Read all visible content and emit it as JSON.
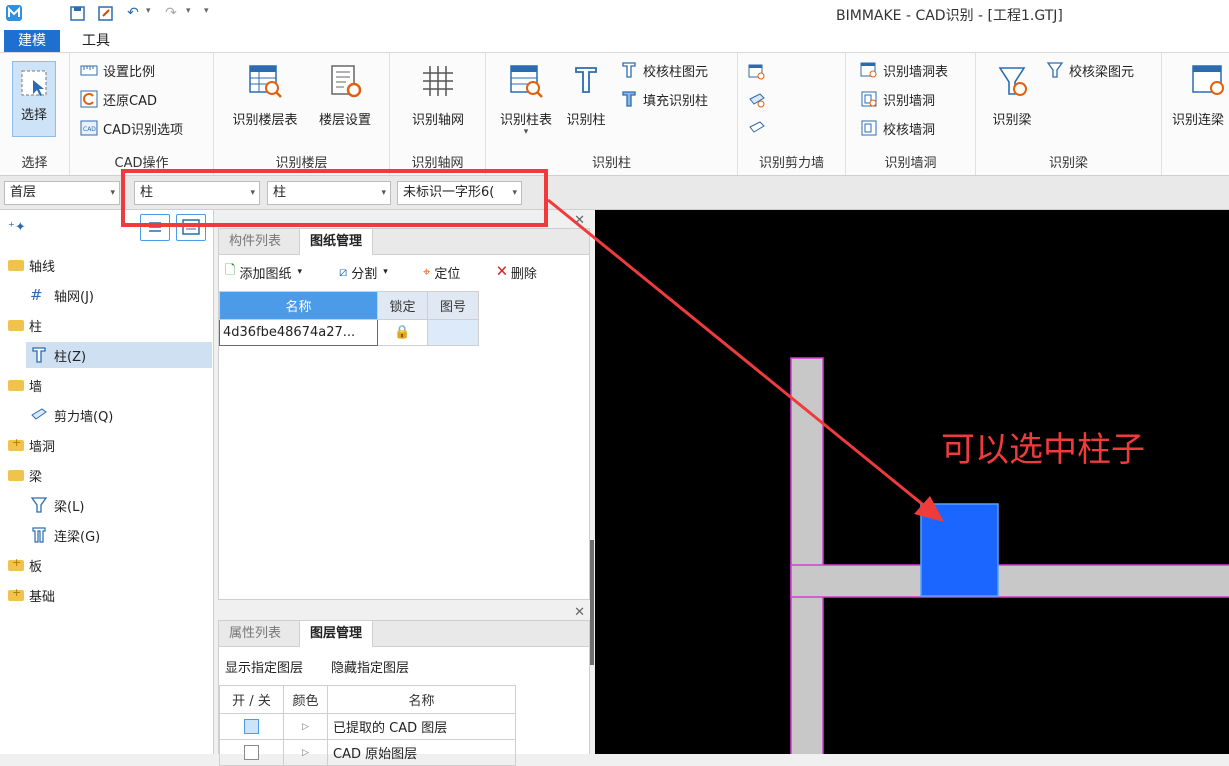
{
  "window": {
    "title": "BIMMAKE - CAD识别 - [工程1.GTJ]"
  },
  "tabs": [
    {
      "label": "建模",
      "active": true
    },
    {
      "label": "工具",
      "active": false
    }
  ],
  "ribbon": {
    "select": {
      "button": "选择",
      "group": "选择"
    },
    "cad_ops": {
      "group": "CAD操作",
      "items": [
        "设置比例",
        "还原CAD",
        "CAD识别选项"
      ]
    },
    "floor": {
      "group": "识别楼层",
      "buttons": [
        "识别楼层表",
        "楼层设置"
      ]
    },
    "axis": {
      "group": "识别轴网",
      "button": "识别轴网"
    },
    "column": {
      "group": "识别柱",
      "buttons": [
        "识别柱表",
        "识别柱"
      ],
      "small": [
        "校核柱图元",
        "填充识别柱"
      ]
    },
    "shearwall": {
      "group": "识别剪力墙"
    },
    "wallhole": {
      "group": "识别墙洞",
      "items": [
        "识别墙洞表",
        "识别墙洞",
        "校核墙洞"
      ]
    },
    "beam": {
      "group": "识别梁",
      "button": "识别梁",
      "small": [
        "校核梁图元"
      ]
    },
    "linkbeam": {
      "button": "识别连梁"
    }
  },
  "filters": {
    "floor": "首层",
    "category": "柱",
    "type": "柱",
    "component": "未标识一字形6("
  },
  "tree": {
    "items": [
      {
        "label": "轴线",
        "kind": "folder"
      },
      {
        "label": "轴网(J)",
        "kind": "child"
      },
      {
        "label": "柱",
        "kind": "folder"
      },
      {
        "label": "柱(Z)",
        "kind": "child",
        "selected": true
      },
      {
        "label": "墙",
        "kind": "folder"
      },
      {
        "label": "剪力墙(Q)",
        "kind": "child"
      },
      {
        "label": "墙洞",
        "kind": "folder-plus"
      },
      {
        "label": "梁",
        "kind": "folder"
      },
      {
        "label": "梁(L)",
        "kind": "child"
      },
      {
        "label": "连梁(G)",
        "kind": "child"
      },
      {
        "label": "板",
        "kind": "folder-plus"
      },
      {
        "label": "基础",
        "kind": "folder-plus"
      }
    ]
  },
  "drawing_panel": {
    "tabs": [
      "构件列表",
      "图纸管理"
    ],
    "toolbar": [
      "添加图纸",
      "分割",
      "定位",
      "删除"
    ],
    "columns": [
      "名称",
      "锁定",
      "图号"
    ],
    "rows": [
      {
        "name": "4d36fbe48674a27..."
      }
    ]
  },
  "layer_panel": {
    "tabs": [
      "属性列表",
      "图层管理"
    ],
    "actions": [
      "显示指定图层",
      "隐藏指定图层"
    ],
    "columns": [
      "开 / 关",
      "颜色",
      "名称"
    ],
    "rows": [
      {
        "name": "已提取的 CAD 图层",
        "checked": true
      },
      {
        "name": "CAD 原始图层",
        "checked": false
      }
    ]
  },
  "canvas": {
    "annotation": "可以选中柱子"
  },
  "colors": {
    "accent": "#1f6fd1",
    "highlight": "#ef3b3b",
    "column_fill": "#1b66ff",
    "wall_fill": "#c8c8c8",
    "wall_edge": "#d63cd6"
  }
}
